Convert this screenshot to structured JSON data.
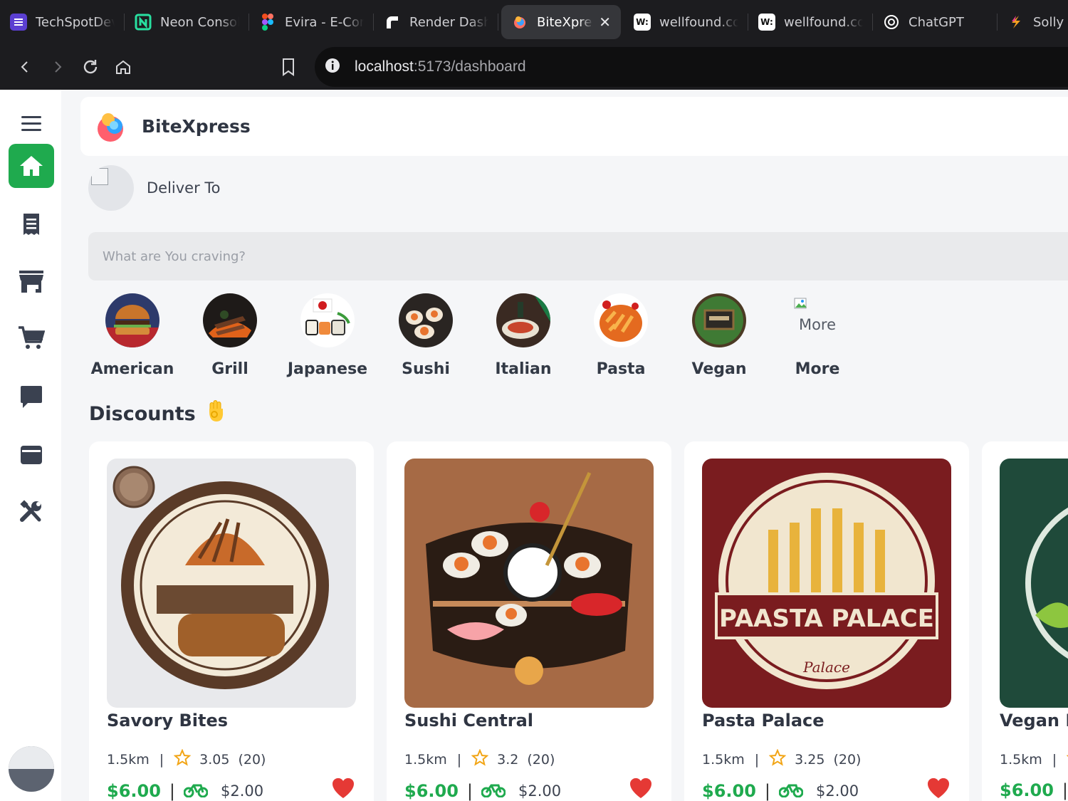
{
  "browser": {
    "tabs": [
      {
        "title": "TechSpotDev",
        "icon": "techspot-icon",
        "color": "#5b3fd1",
        "glyph": "☰"
      },
      {
        "title": "Neon Console",
        "icon": "neon-icon",
        "color": "#1c1c1f",
        "glyph": "N"
      },
      {
        "title": "Evira - E-Commerce",
        "icon": "figma-icon",
        "color": "#1c1c1f",
        "glyph": ""
      },
      {
        "title": "Render Dashboard",
        "icon": "render-icon",
        "color": "#1c1c1f",
        "glyph": ""
      },
      {
        "title": "BiteXpress",
        "icon": "bitexpress-icon",
        "color": "#35363a",
        "glyph": "",
        "active": true
      },
      {
        "title": "wellfound.com",
        "icon": "wellfound-icon",
        "color": "#ffffff",
        "glyph": "W:"
      },
      {
        "title": "wellfound.com",
        "icon": "wellfound-icon",
        "color": "#ffffff",
        "glyph": "W:"
      },
      {
        "title": "ChatGPT",
        "icon": "chatgpt-icon",
        "color": "#1c1c1f",
        "glyph": "⚙"
      },
      {
        "title": "Solly",
        "icon": "solly-icon",
        "color": "#1c1c1f",
        "glyph": ""
      }
    ],
    "url_host": "localhost",
    "url_path": ":5173/dashboard"
  },
  "app": {
    "brand": "BiteXpress",
    "deliver_label": "Deliver To",
    "search_placeholder": "What are You craving?"
  },
  "categories": [
    {
      "label": "American",
      "icon": "burger"
    },
    {
      "label": "Grill",
      "icon": "grill"
    },
    {
      "label": "Japanese",
      "icon": "japanese"
    },
    {
      "label": "Sushi",
      "icon": "sushi"
    },
    {
      "label": "Italian",
      "icon": "italian"
    },
    {
      "label": "Pasta",
      "icon": "pasta"
    },
    {
      "label": "Vegan",
      "icon": "vegan"
    },
    {
      "label": "More",
      "icon": "more",
      "alt": "More"
    }
  ],
  "section": {
    "title": "Discounts",
    "emoji": "👌"
  },
  "restaurants": [
    {
      "name": "Savory Bites",
      "distance": "1.5km",
      "rating": "3.05",
      "reviews": "(20)",
      "price": "$6.00",
      "delivery_fee": "$2.00"
    },
    {
      "name": "Sushi Central",
      "distance": "1.5km",
      "rating": "3.2",
      "reviews": "(20)",
      "price": "$6.00",
      "delivery_fee": "$2.00"
    },
    {
      "name": "Pasta Palace",
      "distance": "1.5km",
      "rating": "3.25",
      "reviews": "(20)",
      "price": "$6.00",
      "delivery_fee": "$2.00"
    },
    {
      "name": "Vegan Delights",
      "distance": "1.5km",
      "rating": "",
      "reviews": "",
      "price": "$6.00",
      "delivery_fee": ""
    }
  ],
  "pasta_logo_text": "PAASTA PALACE",
  "colors": {
    "accent": "#1faa4e",
    "heart": "#e53935",
    "star": "#f2a516"
  }
}
